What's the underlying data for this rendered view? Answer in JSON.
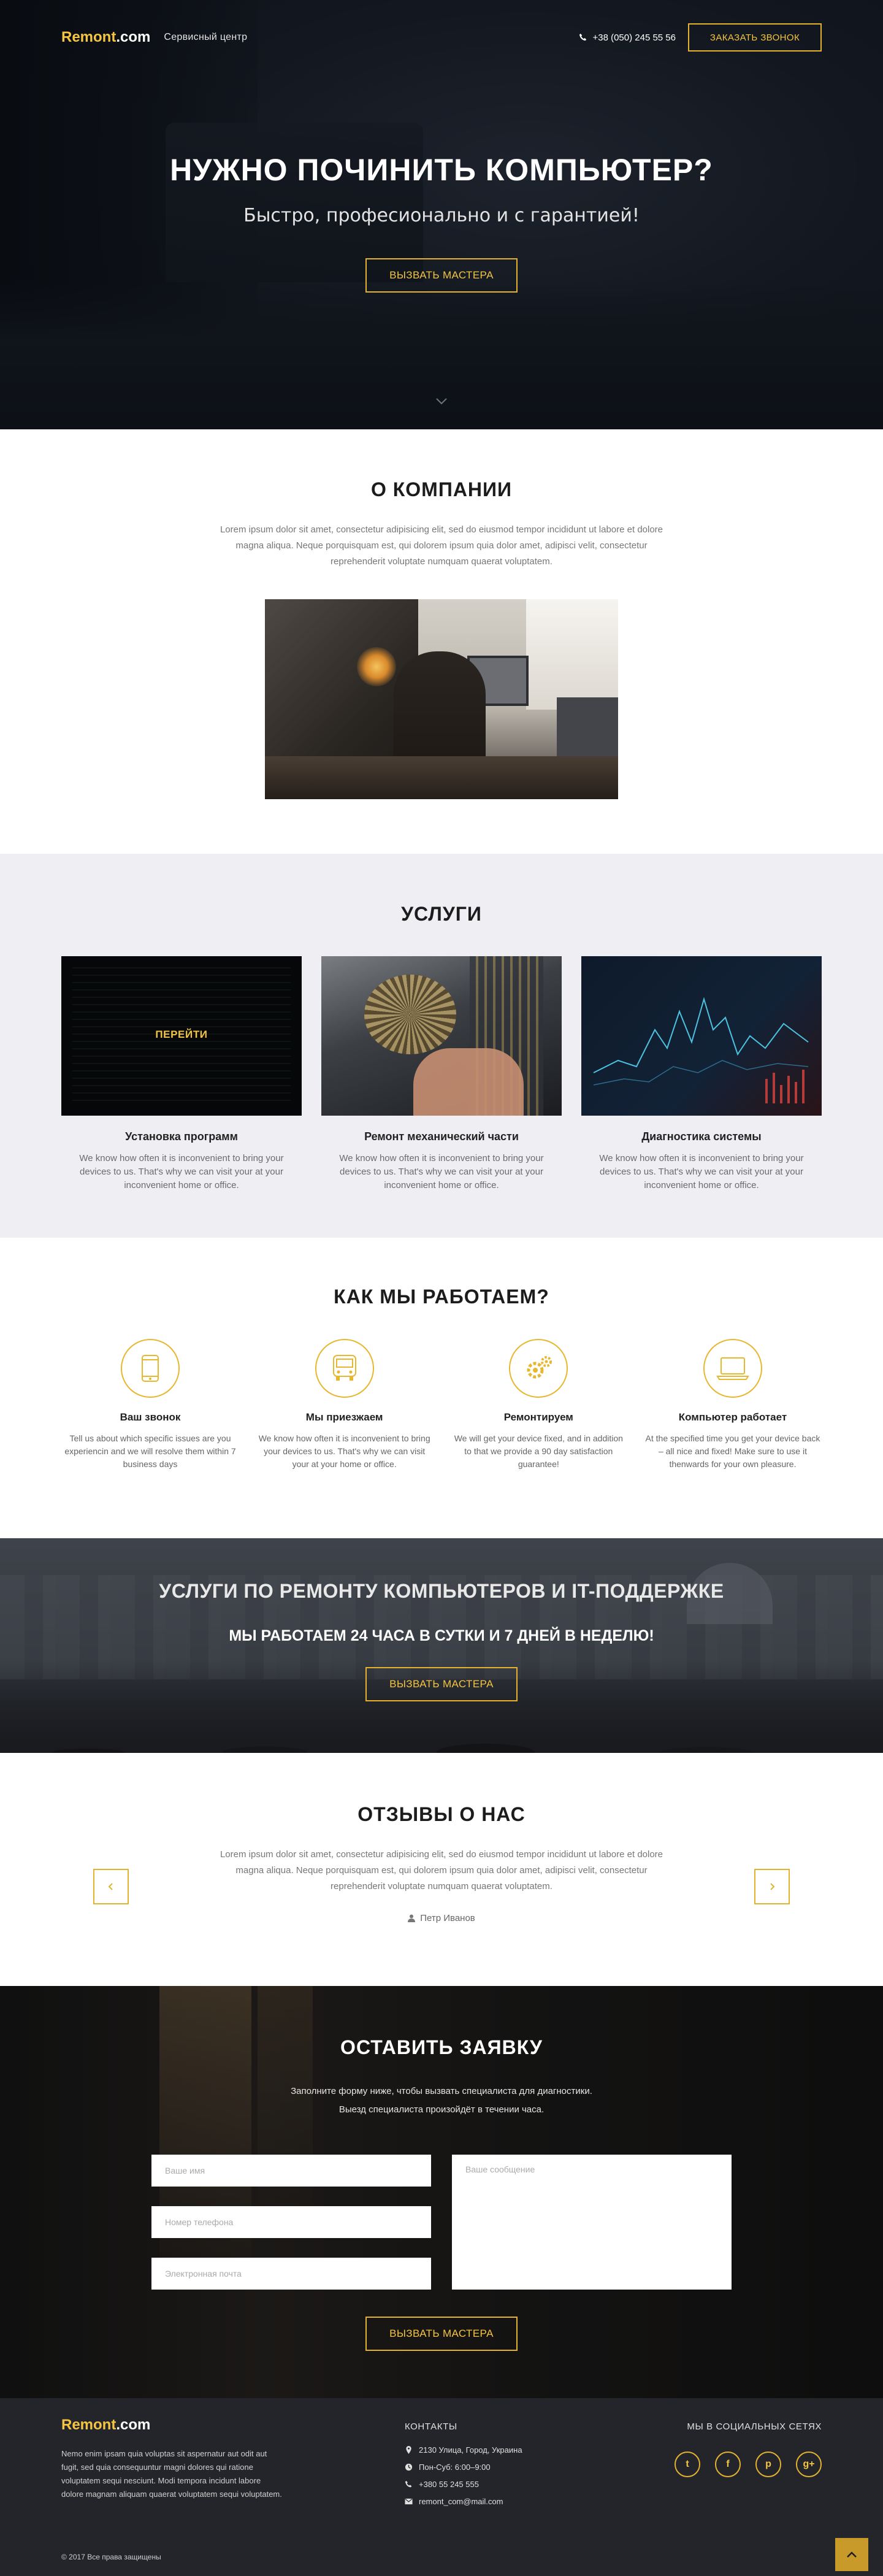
{
  "header": {
    "logo_main": "Remont",
    "logo_suffix": ".com",
    "tagline": "Сервисный центр",
    "phone": "+38 (050) 245 55 56",
    "call_button": "ЗАКАЗАТЬ ЗВОНОК",
    "phone_icon": "phone-icon"
  },
  "hero": {
    "title": "НУЖНО ПОЧИНИТЬ КОМПЬЮТЕР?",
    "subtitle": "Быстро, професионально и с гарантией!",
    "button": "ВЫЗВАТЬ МАСТЕРА",
    "scroll_icon": "chevron-down-icon"
  },
  "about": {
    "title": "О КОМПАНИИ",
    "text": "Lorem ipsum dolor sit amet, consectetur adipisicing elit, sed do eiusmod tempor incididunt ut labore et dolore magna aliqua. Neque porquisquam est, qui dolorem ipsum quia dolor amet, adipisci velit, consectetur reprehenderit voluptate numquam quaerat voluptatem."
  },
  "services": {
    "title": "УСЛУГИ",
    "link_label": "ПЕРЕЙТИ",
    "items": [
      {
        "title": "Установка программ",
        "text": "We know how often it is inconvenient to bring your devices to us. That's why we can visit your at your inconvenient home or office."
      },
      {
        "title": "Ремонт механический части",
        "text": "We know how often it is inconvenient to bring your devices to us. That's why we can visit your at your inconvenient home or office."
      },
      {
        "title": "Диагностика системы",
        "text": "We know how often it is inconvenient to bring your devices to us. That's why we can visit your at your inconvenient home or office."
      }
    ]
  },
  "how": {
    "title": "КАК МЫ РАБОТАЕМ?",
    "steps": [
      {
        "icon": "smartphone-icon",
        "title": "Ваш звонок",
        "text": "Tell us about which specific issues are you experiencin and we will resolve them within 7 business days"
      },
      {
        "icon": "bus-icon",
        "title": "Мы приезжаем",
        "text": "We know how often it is inconvenient to bring your devices to us. That's why we can visit your at your home or office."
      },
      {
        "icon": "gears-icon",
        "title": "Ремонтируем",
        "text": "We will get your device fixed, and in addition to that we provide a 90 day satisfaction guarantee!"
      },
      {
        "icon": "laptop-icon",
        "title": "Компьютер работает",
        "text": "At the specified time you get your device back – all nice and fixed! Make sure to use it thenwards for your own pleasure."
      }
    ]
  },
  "banner": {
    "title": "УСЛУГИ ПО РЕМОНТУ КОМПЬЮТЕРОВ И IT-ПОДДЕРЖКЕ",
    "subtitle": "МЫ РАБОТАЕМ 24 ЧАСА В СУТКИ И 7 ДНЕЙ В НЕДЕЛЮ!",
    "button": "ВЫЗВАТЬ МАСТЕРА"
  },
  "reviews": {
    "title": "ОТЗЫВЫ О НАС",
    "text": "Lorem ipsum dolor sit amet, consectetur adipisicing elit, sed do eiusmod tempor incididunt ut labore et dolore magna aliqua. Neque porquisquam est, qui dolorem ipsum quia dolor amet, adipisci velit, consectetur reprehenderit voluptate numquam quaerat voluptatem.",
    "author": "Петр Иванов",
    "prev_icon": "chevron-left-icon",
    "next_icon": "chevron-right-icon"
  },
  "order": {
    "title": "ОСТАВИТЬ ЗАЯВКУ",
    "lead_1": "Заполните форму ниже, чтобы вызвать специалиста для диагностики.",
    "lead_2": "Выезд специалиста произойдёт в течении часа.",
    "name_placeholder": "Ваше имя",
    "phone_placeholder": "Номер телефона",
    "email_placeholder": "Электронная почта",
    "message_placeholder": "Ваше сообщение",
    "button": "ВЫЗВАТЬ МАСТЕРА"
  },
  "footer": {
    "about_text": "Nemo enim ipsam quia voluptas sit aspernatur aut odit aut fugit, sed quia consequuntur magni dolores qui ratione voluptatem sequi nesciunt. Modi tempora incidunt  labore dolore magnam aliquam quaerat voluptatem sequi voluptatem.",
    "contacts_title": "КОНТАКТЫ",
    "contacts": [
      {
        "icon": "map-marker-icon",
        "text": "2130 Улица, Город, Украина"
      },
      {
        "icon": "clock-icon",
        "text": "Пон-Суб: 6:00–9:00"
      },
      {
        "icon": "phone-icon",
        "text": "+380 55 245 555"
      },
      {
        "icon": "envelope-icon",
        "text": "remont_com@mail.com"
      }
    ],
    "social_title": "МЫ В СОЦИАЛЬНЫХ СЕТЯХ",
    "social": [
      {
        "icon": "twitter-icon",
        "glyph": "t"
      },
      {
        "icon": "facebook-icon",
        "glyph": "f"
      },
      {
        "icon": "pinterest-icon",
        "glyph": "p"
      },
      {
        "icon": "google-plus-icon",
        "glyph": "g+"
      }
    ],
    "copyright": "© 2017 Все права защищены",
    "to_top_icon": "chevron-up-icon"
  },
  "colors": {
    "accent": "#f4c542",
    "hero_bg": "#161c24",
    "section_alt_bg": "#efeff3",
    "footer_bg": "#23252b"
  }
}
